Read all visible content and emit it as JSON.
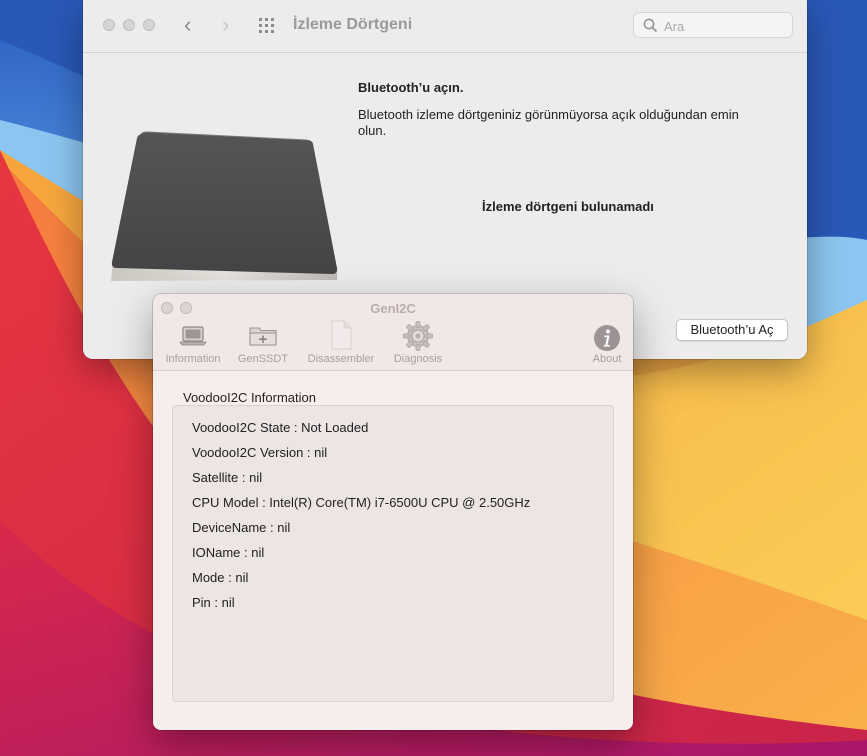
{
  "preferences_window": {
    "title": "İzleme Dörtgeni",
    "search": {
      "placeholder": "Ara",
      "value": ""
    },
    "bluetooth_heading": "Bluetooth’u açın.",
    "bluetooth_description": "Bluetooth izleme dörtgeniniz görünmüyorsa açık olduğundan emin olun.",
    "not_found_message": "İzleme dörtgeni bulunamadı",
    "bluetooth_button": "Bluetooth’u Aç",
    "icons": [
      "close-icon",
      "minimize-icon",
      "zoom-icon",
      "chevron-left-icon",
      "chevron-right-icon",
      "grid-icon",
      "search-icon",
      "trackpad-icon"
    ]
  },
  "geni2c_window": {
    "title": "GenI2C",
    "toolbar": [
      {
        "label": "Information",
        "icon": "laptop-icon"
      },
      {
        "label": "GenSSDT",
        "icon": "folder-add-icon"
      },
      {
        "label": "Disassembler",
        "icon": "document-icon"
      },
      {
        "label": "Diagnosis",
        "icon": "gear-icon"
      },
      {
        "label": "About",
        "icon": "info-icon"
      }
    ],
    "section_title": "VoodooI2C Information",
    "info_lines": [
      "VoodooI2C State : Not Loaded",
      "VoodooI2C Version : nil",
      "Satellite : nil",
      "CPU Model : Intel(R) Core(TM) i7-6500U CPU @ 2.50GHz",
      "DeviceName : nil",
      "IOName : nil",
      "Mode : nil",
      "Pin : nil"
    ]
  },
  "colors": {
    "wallpaper_blue": "#2f6fd0",
    "wallpaper_red": "#e8364a",
    "wallpaper_orange": "#f39a3c",
    "wallpaper_yellow": "#f8c44a",
    "window_bg": "#ececec",
    "geni_bg": "#f8eded"
  }
}
